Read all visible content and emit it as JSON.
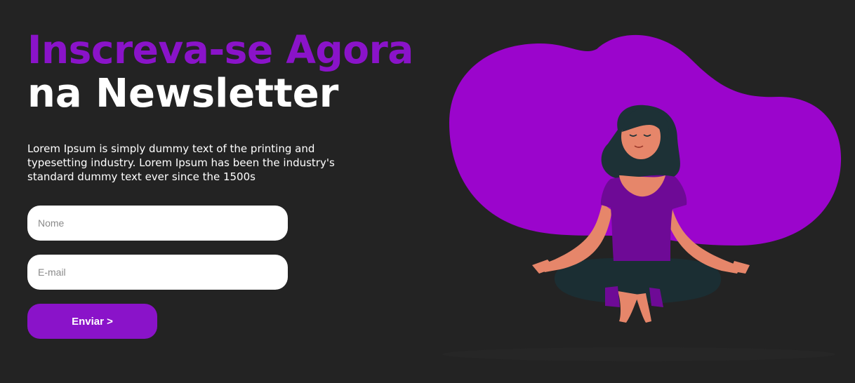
{
  "hero": {
    "title_line1": "Inscreva-se Agora",
    "title_line2": "na Newsletter",
    "description": "Lorem Ipsum is simply dummy text of the printing and typesetting industry. Lorem Ipsum has been the industry's standard dummy text ever since the 1500s"
  },
  "form": {
    "name_placeholder": "Nome",
    "email_placeholder": "E-mail",
    "submit_label": "Enviar >"
  },
  "colors": {
    "background": "#232323",
    "accent": "#8a13c9",
    "blob": "#9b05cc",
    "title_secondary": "#ffffff"
  },
  "illustration": {
    "icon": "meditating-woman-illustration"
  }
}
